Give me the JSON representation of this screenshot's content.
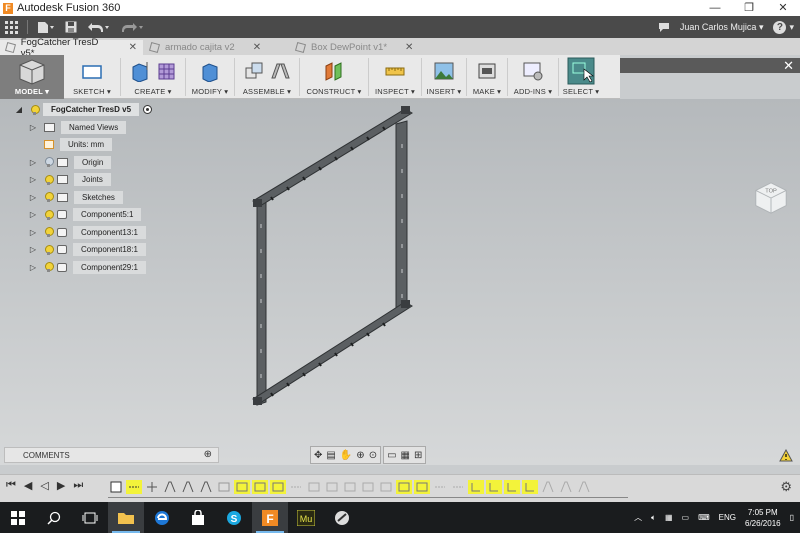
{
  "window": {
    "title": "Autodesk Fusion 360",
    "controls": [
      "—",
      "❐",
      "✕"
    ]
  },
  "quick_access": {
    "user_name": "Juan Carlos Mujica",
    "user_caret": "▾",
    "help": "?"
  },
  "tabs": [
    {
      "label": "FogCatcher TresD v5*",
      "active": true
    },
    {
      "label": "armado cajita v2",
      "active": false
    },
    {
      "label": "Box DewPoint v1*",
      "active": false
    }
  ],
  "tab_close": "✕",
  "toolbar": {
    "groups": [
      {
        "label": "MODEL ▾"
      },
      {
        "label": "SKETCH ▾"
      },
      {
        "label": "CREATE ▾"
      },
      {
        "label": "MODIFY ▾"
      },
      {
        "label": "ASSEMBLE ▾"
      },
      {
        "label": "CONSTRUCT ▾"
      },
      {
        "label": "INSPECT ▾"
      },
      {
        "label": "INSERT ▾"
      },
      {
        "label": "MAKE ▾"
      },
      {
        "label": "ADD-INS ▾"
      },
      {
        "label": "SELECT ▾"
      }
    ],
    "close": "✕"
  },
  "browser": {
    "root": "FogCatcher TresD v5",
    "items": [
      {
        "label": "Named Views",
        "bulb": "none",
        "icon": "folder"
      },
      {
        "label": "Units: mm",
        "bulb": "none",
        "icon": "units"
      },
      {
        "label": "Origin",
        "bulb": "off",
        "icon": "folder"
      },
      {
        "label": "Joints",
        "bulb": "on",
        "icon": "folder"
      },
      {
        "label": "Sketches",
        "bulb": "on",
        "icon": "folder"
      },
      {
        "label": "Component5:1",
        "bulb": "on",
        "icon": "component"
      },
      {
        "label": "Component13:1",
        "bulb": "on",
        "icon": "component"
      },
      {
        "label": "Component18:1",
        "bulb": "on",
        "icon": "component"
      },
      {
        "label": "Component29:1",
        "bulb": "on",
        "icon": "component"
      }
    ]
  },
  "viewcube": {
    "label": "TOP"
  },
  "comments": {
    "label": "COMMENTS"
  },
  "taskbar": {
    "time": "7:05 PM",
    "date": "6/26/2016",
    "lang": "ENG"
  },
  "colors": {
    "timeline_highlight": "#f3f33a",
    "toolbar_model_bg": "#7e7e7e",
    "taskbar_bg": "#1a1c1e"
  }
}
